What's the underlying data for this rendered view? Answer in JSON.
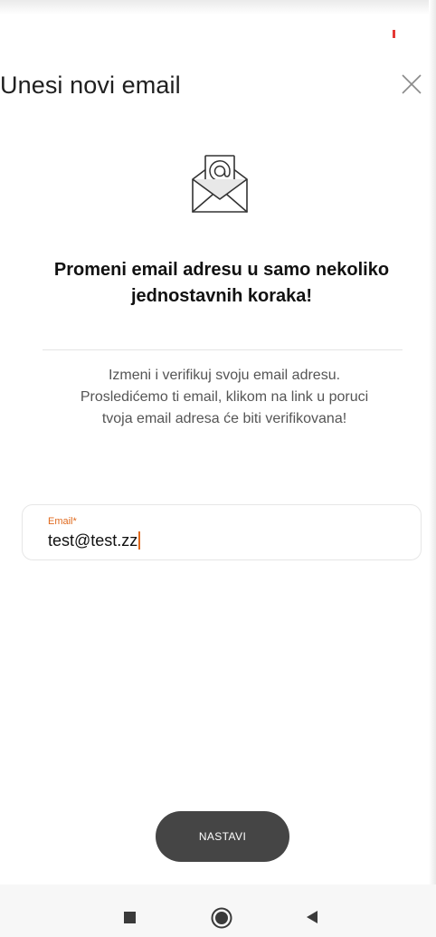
{
  "header": {
    "title": "Unesi novi email"
  },
  "icons": {
    "close": "close-icon",
    "envelope": "envelope-at-icon",
    "recents": "recents-square-icon",
    "home": "home-circle-icon",
    "back": "back-triangle-icon"
  },
  "main": {
    "headline": "Promeni email adresu u samo nekoliko jednostavnih koraka!",
    "description": "Izmeni i verifikuj svoju email adresu. Prosledićemo ti email, klikom na link u poruci tvoja email adresa će biti verifikovana!"
  },
  "email_field": {
    "label": "Email*",
    "value": "test@test.zz"
  },
  "actions": {
    "continue_label": "NASTAVI"
  },
  "colors": {
    "accent": "#e06a1e",
    "button": "#454545",
    "status_indicator": "#e53935"
  }
}
